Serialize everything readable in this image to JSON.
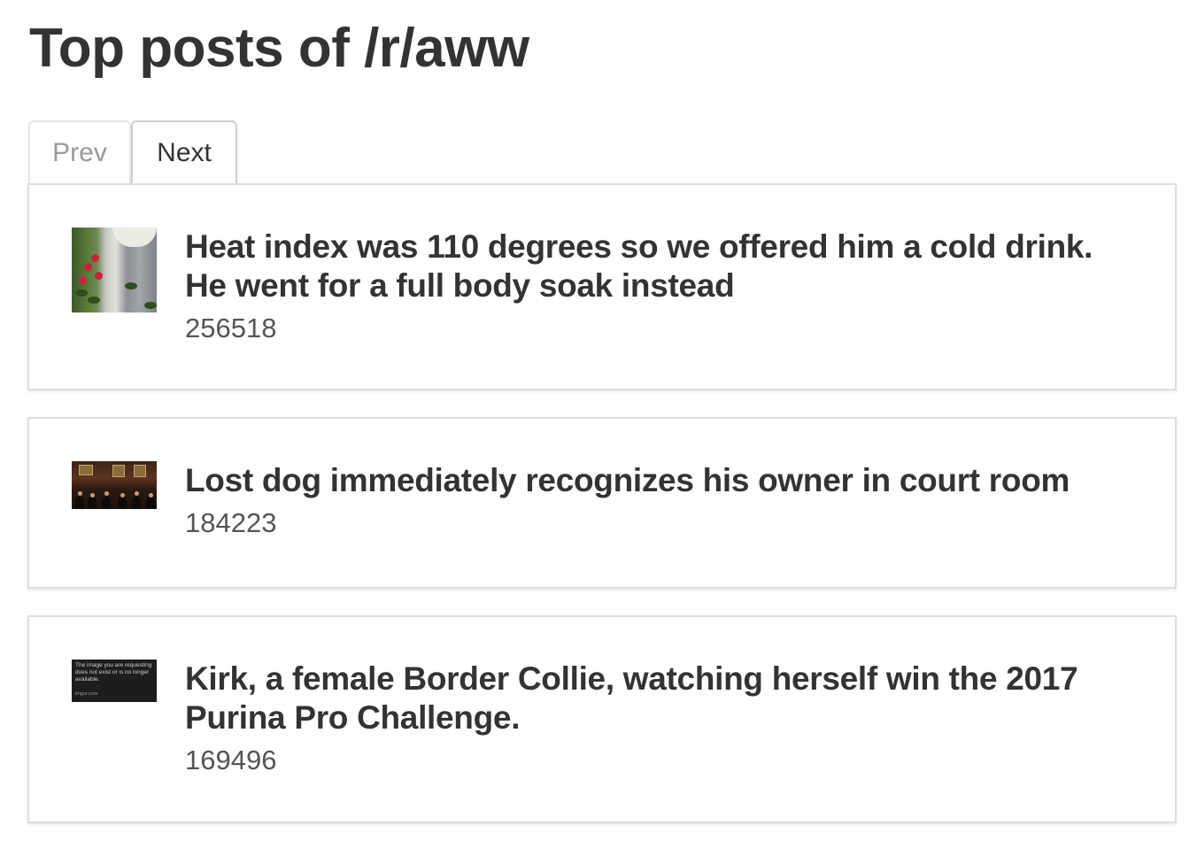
{
  "page": {
    "title": "Top posts of /r/aww"
  },
  "pager": {
    "prev_label": "Prev",
    "next_label": "Next",
    "prev_disabled": true
  },
  "posts": [
    {
      "title": "Heat index was 110 degrees so we offered him a cold drink. He went for a full body soak instead",
      "score": "256518",
      "thumbnail_alt": "garden-thumbnail"
    },
    {
      "title": "Lost dog immediately recognizes his owner in court room",
      "score": "184223",
      "thumbnail_alt": "court-room-thumbnail"
    },
    {
      "title": "Kirk, a female Border Collie, watching herself win the 2017 Purina Pro Challenge.",
      "score": "169496",
      "thumbnail_alt": "removed-image-thumbnail",
      "thumbnail_text": "The image you are requesting does not exist or is no longer available.",
      "thumbnail_domain": "imgur.com"
    }
  ],
  "colors": {
    "text": "#333333",
    "muted": "#999999",
    "border": "#dddddd",
    "background": "#ffffff"
  }
}
